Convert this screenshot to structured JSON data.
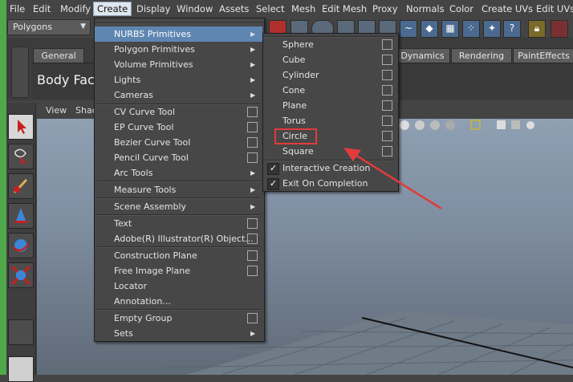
{
  "menubar": {
    "items": [
      "File",
      "Edit",
      "Modify",
      "Create",
      "Display",
      "Window",
      "Assets",
      "Select",
      "Mesh",
      "Edit Mesh",
      "Proxy",
      "Normals",
      "Color",
      "Create UVs",
      "Edit UVs"
    ]
  },
  "toolbar": {
    "mode_value": "Polygons",
    "help_label": "?"
  },
  "shelf": {
    "tabs": [
      "General",
      "Dynamics",
      "Rendering",
      "PaintEffects"
    ],
    "title": "Body Face"
  },
  "viewport_menu": {
    "view": "View",
    "shading": "Shac"
  },
  "create_menu": {
    "items": [
      "NURBS Primitives",
      "Polygon Primitives",
      "Volume Primitives",
      "Lights",
      "Cameras",
      "CV Curve Tool",
      "EP Curve Tool",
      "Bezier Curve Tool",
      "Pencil Curve Tool",
      "Arc Tools",
      "Measure Tools",
      "Scene Assembly",
      "Text",
      "Adobe(R) Illustrator(R) Object...",
      "Construction Plane",
      "Free Image Plane",
      "Locator",
      "Annotation...",
      "Empty Group",
      "Sets"
    ]
  },
  "nurbs_menu": {
    "items": [
      "Sphere",
      "Cube",
      "Cylinder",
      "Cone",
      "Plane",
      "Torus",
      "Circle",
      "Square"
    ],
    "interactive_creation": "Interactive Creation",
    "exit_on_completion": "Exit On Completion",
    "check_mark": "✓"
  },
  "colors": {
    "highlight": "#5e86b1",
    "annotation_red": "#e23b3b",
    "frame_green": "#4fa84a"
  }
}
